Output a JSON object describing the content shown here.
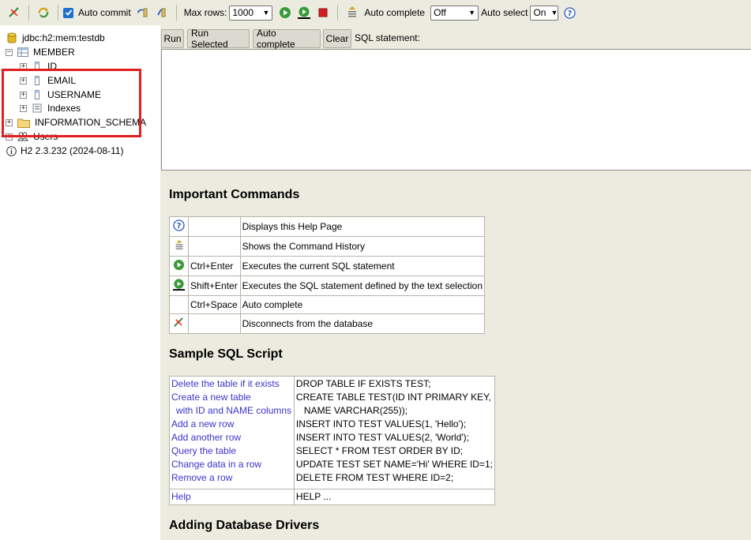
{
  "toolbar": {
    "auto_commit_label": "Auto commit",
    "max_rows_label": "Max rows:",
    "max_rows_value": "1000",
    "auto_complete_label": "Auto complete",
    "auto_complete_value": "Off",
    "auto_select_label": "Auto select",
    "auto_select_value": "On"
  },
  "tree": {
    "connection": "jdbc:h2:mem:testdb",
    "table": "MEMBER",
    "columns": [
      "ID",
      "EMAIL",
      "USERNAME"
    ],
    "indexes": "Indexes",
    "schema": "INFORMATION_SCHEMA",
    "users": "Users",
    "version": "H2 2.3.232 (2024-08-11)"
  },
  "editor": {
    "run": "Run",
    "run_selected": "Run Selected",
    "auto_complete": "Auto complete",
    "clear": "Clear",
    "sql_label": "SQL statement:"
  },
  "help": {
    "important_title": "Important Commands",
    "commands": [
      {
        "icon": "help-icon",
        "key": "",
        "desc": "Displays this Help Page"
      },
      {
        "icon": "history-icon",
        "key": "",
        "desc": "Shows the Command History"
      },
      {
        "icon": "run-icon",
        "key": "Ctrl+Enter",
        "desc": "Executes the current SQL statement"
      },
      {
        "icon": "run-selected-icon",
        "key": "Shift+Enter",
        "desc": "Executes the SQL statement defined by the text selection"
      },
      {
        "icon": "",
        "key": "Ctrl+Space",
        "desc": "Auto complete"
      },
      {
        "icon": "disconnect-icon",
        "key": "",
        "desc": "Disconnects from the database"
      }
    ],
    "sample_title": "Sample SQL Script",
    "sample_links": [
      "Delete the table if it exists",
      "Create a new table",
      "with ID and NAME columns",
      "Add a new row",
      "Add another row",
      "Query the table",
      "Change data in a row",
      "Remove a row"
    ],
    "sample_sql": [
      "DROP TABLE IF EXISTS TEST;",
      "CREATE TABLE TEST(ID INT PRIMARY KEY,",
      "NAME VARCHAR(255));",
      "INSERT INTO TEST VALUES(1, 'Hello');",
      "INSERT INTO TEST VALUES(2, 'World');",
      "SELECT * FROM TEST ORDER BY ID;",
      "UPDATE TEST SET NAME='Hi' WHERE ID=1;",
      "DELETE FROM TEST WHERE ID=2;"
    ],
    "help_link": "Help",
    "help_sql": "HELP ...",
    "drivers_title": "Adding Database Drivers"
  },
  "colors": {
    "panel_bg": "#ecebdf",
    "link": "#3a34c8",
    "highlight": "#e02020"
  }
}
